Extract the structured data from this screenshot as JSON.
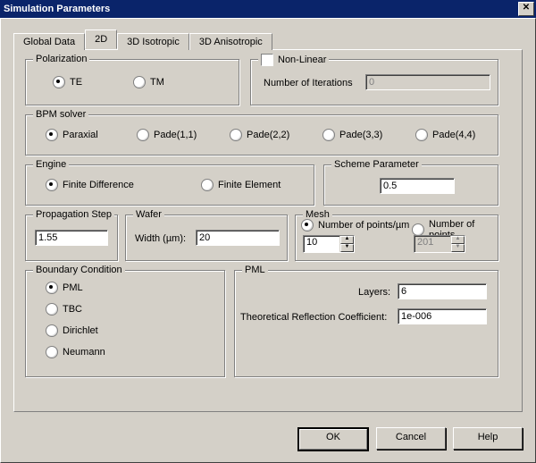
{
  "window": {
    "title": "Simulation Parameters"
  },
  "tabs": [
    "Global Data",
    "2D",
    "3D Isotropic",
    "3D Anisotropic"
  ],
  "selected_tab_index": 1,
  "polarization": {
    "legend": "Polarization",
    "te": "TE",
    "tm": "TM",
    "selected": "TE"
  },
  "nonlinear": {
    "checkbox": "Non-Linear",
    "iter_label": "Number of Iterations",
    "iter_value": "0",
    "checked": false
  },
  "bpm": {
    "legend": "BPM solver",
    "options": [
      "Paraxial",
      "Pade(1,1)",
      "Pade(2,2)",
      "Pade(3,3)",
      "Pade(4,4)"
    ],
    "selected": "Paraxial"
  },
  "engine": {
    "legend": "Engine",
    "fd": "Finite Difference",
    "fe": "Finite Element",
    "selected": "Finite Difference"
  },
  "scheme": {
    "legend": "Scheme Parameter",
    "value": "0.5"
  },
  "prop": {
    "legend": "Propagation Step",
    "value": "1.55"
  },
  "wafer": {
    "legend": "Wafer",
    "width_label": "Width (µm):",
    "width_value": "20"
  },
  "mesh": {
    "legend": "Mesh",
    "per_um_label": "Number of points/µm",
    "count_label": "Number of points",
    "selected": "per_um",
    "per_um_value": "10",
    "count_value": "201"
  },
  "boundary": {
    "legend": "Boundary Condition",
    "options": [
      "PML",
      "TBC",
      "Dirichlet",
      "Neumann"
    ],
    "selected": "PML"
  },
  "pml": {
    "legend": "PML",
    "layers_label": "Layers:",
    "layers_value": "6",
    "trc_label": "Theoretical Reflection Coefficient:",
    "trc_value": "1e-006"
  },
  "buttons": {
    "ok": "OK",
    "cancel": "Cancel",
    "help": "Help"
  }
}
